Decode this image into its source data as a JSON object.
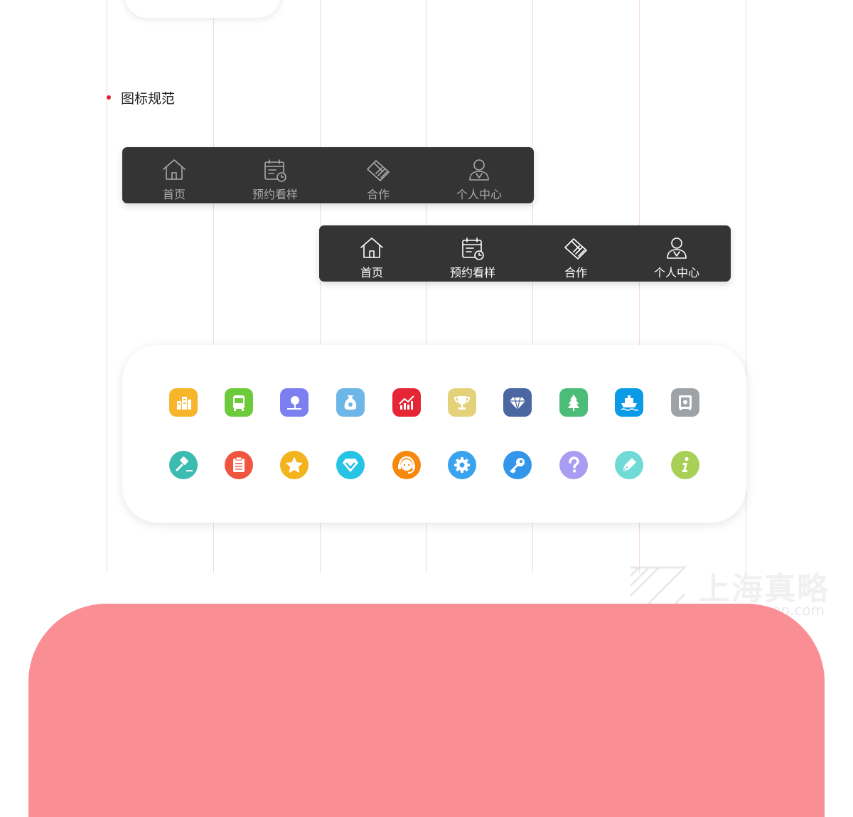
{
  "section_title": "图标规范",
  "tabbar": {
    "tabs": [
      {
        "label": "首页",
        "icon": "home-icon"
      },
      {
        "label": "预约看样",
        "icon": "calendar-clock-icon"
      },
      {
        "label": "合作",
        "icon": "handshake-icon"
      },
      {
        "label": "个人中心",
        "icon": "user-icon"
      }
    ],
    "colors": {
      "background": "#343434",
      "inactive": "#a9a9a9",
      "active": "#ffffff"
    }
  },
  "icon_grid": {
    "row1": [
      {
        "icon": "buildings-icon",
        "color": "#f7b52c"
      },
      {
        "icon": "bus-icon",
        "color": "#6ccb3b"
      },
      {
        "icon": "park-tree-icon",
        "color": "#7b7ff0"
      },
      {
        "icon": "money-bag-icon",
        "color": "#6db6e8"
      },
      {
        "icon": "trend-chart-icon",
        "color": "#e62535"
      },
      {
        "icon": "trophy-icon",
        "color": "#e4d27b"
      },
      {
        "icon": "diamond-icon",
        "color": "#4a67a2"
      },
      {
        "icon": "pine-tree-icon",
        "color": "#4bbd78"
      },
      {
        "icon": "ship-icon",
        "color": "#0b9ae6"
      },
      {
        "icon": "safe-icon",
        "color": "#9ea3a8"
      }
    ],
    "row2": [
      {
        "icon": "gavel-icon",
        "color": "#3bbcb0"
      },
      {
        "icon": "clipboard-icon",
        "color": "#f0553f"
      },
      {
        "icon": "star-icon",
        "color": "#f2b31d"
      },
      {
        "icon": "heart-diamond-icon",
        "color": "#27c3e4"
      },
      {
        "icon": "headset-icon",
        "color": "#f7880e"
      },
      {
        "icon": "gear-icon",
        "color": "#3aa3ee"
      },
      {
        "icon": "key-icon",
        "color": "#3496ea"
      },
      {
        "icon": "question-icon",
        "color": "#a99df3"
      },
      {
        "icon": "pen-icon",
        "color": "#6fdad6"
      },
      {
        "icon": "info-icon",
        "color": "#a8cf56"
      }
    ]
  },
  "watermark": {
    "name": "上海真略",
    "url": "www.cnzlapp.com"
  },
  "accent_color": "#e0202e"
}
